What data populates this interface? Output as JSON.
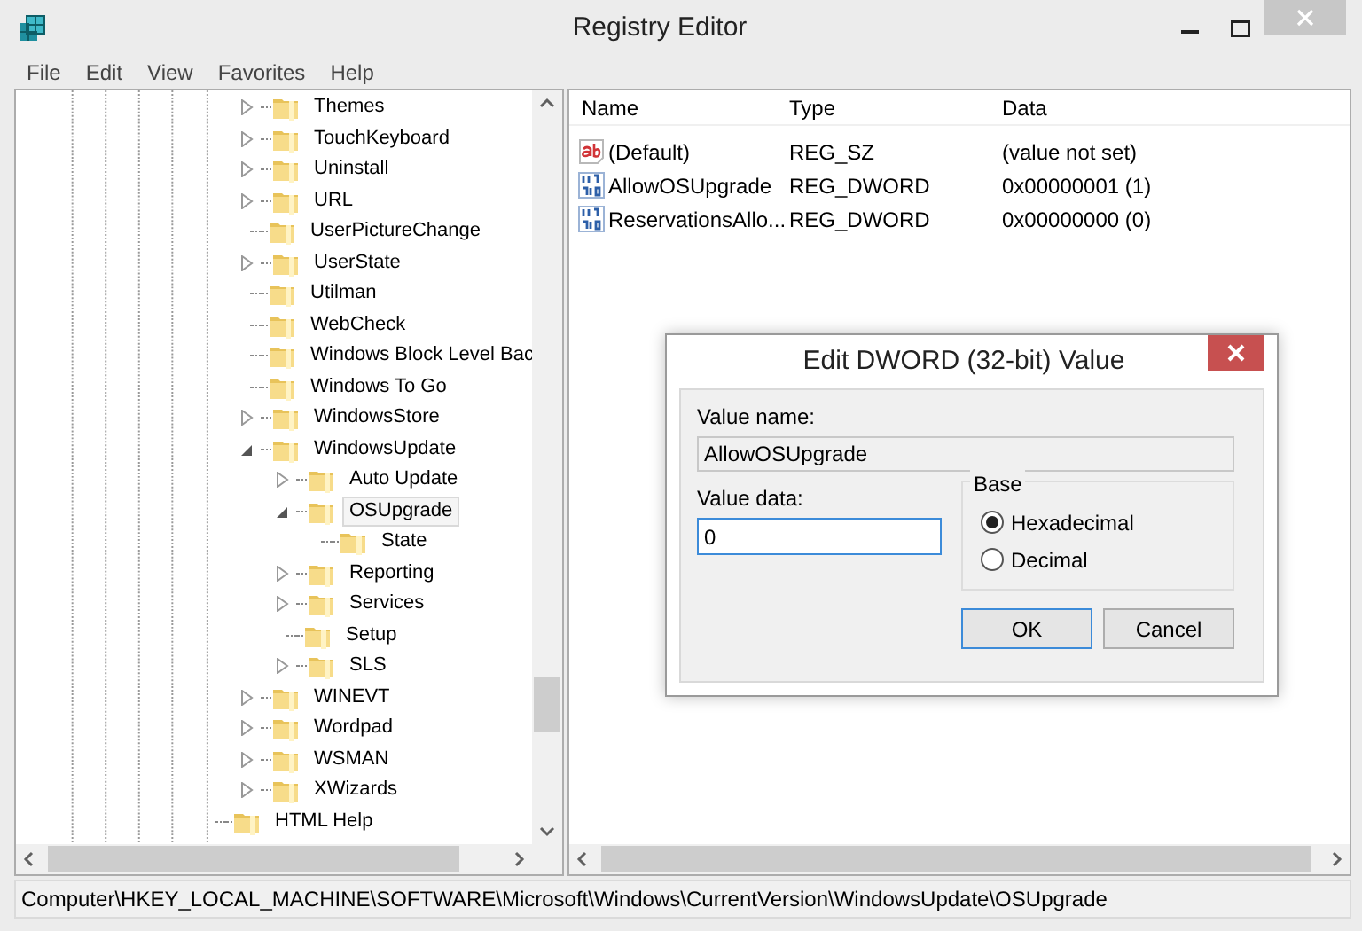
{
  "window": {
    "title": "Registry Editor"
  },
  "menu": [
    "File",
    "Edit",
    "View",
    "Favorites",
    "Help"
  ],
  "tree": {
    "nodes": [
      {
        "children": [
          {
            "label": "Themes",
            "expanded": false,
            "selected": false
          },
          {
            "label": "TouchKeyboard",
            "expanded": false,
            "selected": false
          },
          {
            "label": "Uninstall",
            "expanded": false,
            "selected": false
          },
          {
            "label": "URL",
            "expanded": false,
            "selected": false
          },
          {
            "label": "UserPictureChange",
            "selected": false
          },
          {
            "label": "UserState",
            "expanded": false,
            "selected": false
          },
          {
            "label": "Utilman",
            "selected": false
          },
          {
            "label": "WebCheck",
            "selected": false
          },
          {
            "label": "Windows Block Level Bac",
            "selected": false
          },
          {
            "label": "Windows To Go",
            "selected": false
          },
          {
            "label": "WindowsStore",
            "expanded": false,
            "selected": false
          },
          {
            "label": "WindowsUpdate",
            "expanded": true,
            "selected": false,
            "children": [
              {
                "label": "Auto Update",
                "expanded": false,
                "selected": false
              },
              {
                "label": "OSUpgrade",
                "expanded": true,
                "selected": true,
                "children": [
                  {
                    "label": "State",
                    "selected": false
                  }
                ]
              },
              {
                "label": "Reporting",
                "expanded": false,
                "selected": false
              },
              {
                "label": "Services",
                "expanded": false,
                "selected": false
              },
              {
                "label": "Setup",
                "selected": false
              },
              {
                "label": "SLS",
                "expanded": false,
                "selected": false
              }
            ]
          },
          {
            "label": "WINEVT",
            "expanded": false,
            "selected": false
          },
          {
            "label": "Wordpad",
            "expanded": false,
            "selected": false
          },
          {
            "label": "WSMAN",
            "expanded": false,
            "selected": false
          },
          {
            "label": "XWizards",
            "expanded": false,
            "selected": false
          }
        ]
      },
      {
        "label": "HTML Help",
        "selected": false
      }
    ]
  },
  "values": {
    "columns": [
      "Name",
      "Type",
      "Data"
    ],
    "rows": [
      {
        "kind": "string",
        "name": "(Default)",
        "type": "REG_SZ",
        "data": "(value not set)"
      },
      {
        "kind": "binary",
        "name": "AllowOSUpgrade",
        "type": "REG_DWORD",
        "data": "0x00000001 (1)"
      },
      {
        "kind": "binary",
        "name": "ReservationsAllo...",
        "type": "REG_DWORD",
        "data": "0x00000000 (0)"
      }
    ]
  },
  "status_bar": "Computer\\HKEY_LOCAL_MACHINE\\SOFTWARE\\Microsoft\\Windows\\CurrentVersion\\WindowsUpdate\\OSUpgrade",
  "dialog": {
    "title": "Edit DWORD (32-bit) Value",
    "value_name_label": "Value name:",
    "value_name": "AllowOSUpgrade",
    "value_data_label": "Value data:",
    "value_data": "0",
    "base_label": "Base",
    "base_options": [
      {
        "label": "Hexadecimal",
        "selected": true
      },
      {
        "label": "Decimal",
        "selected": false
      }
    ],
    "buttons": [
      {
        "label": "OK",
        "default": true
      },
      {
        "label": "Cancel",
        "default": false
      }
    ]
  }
}
